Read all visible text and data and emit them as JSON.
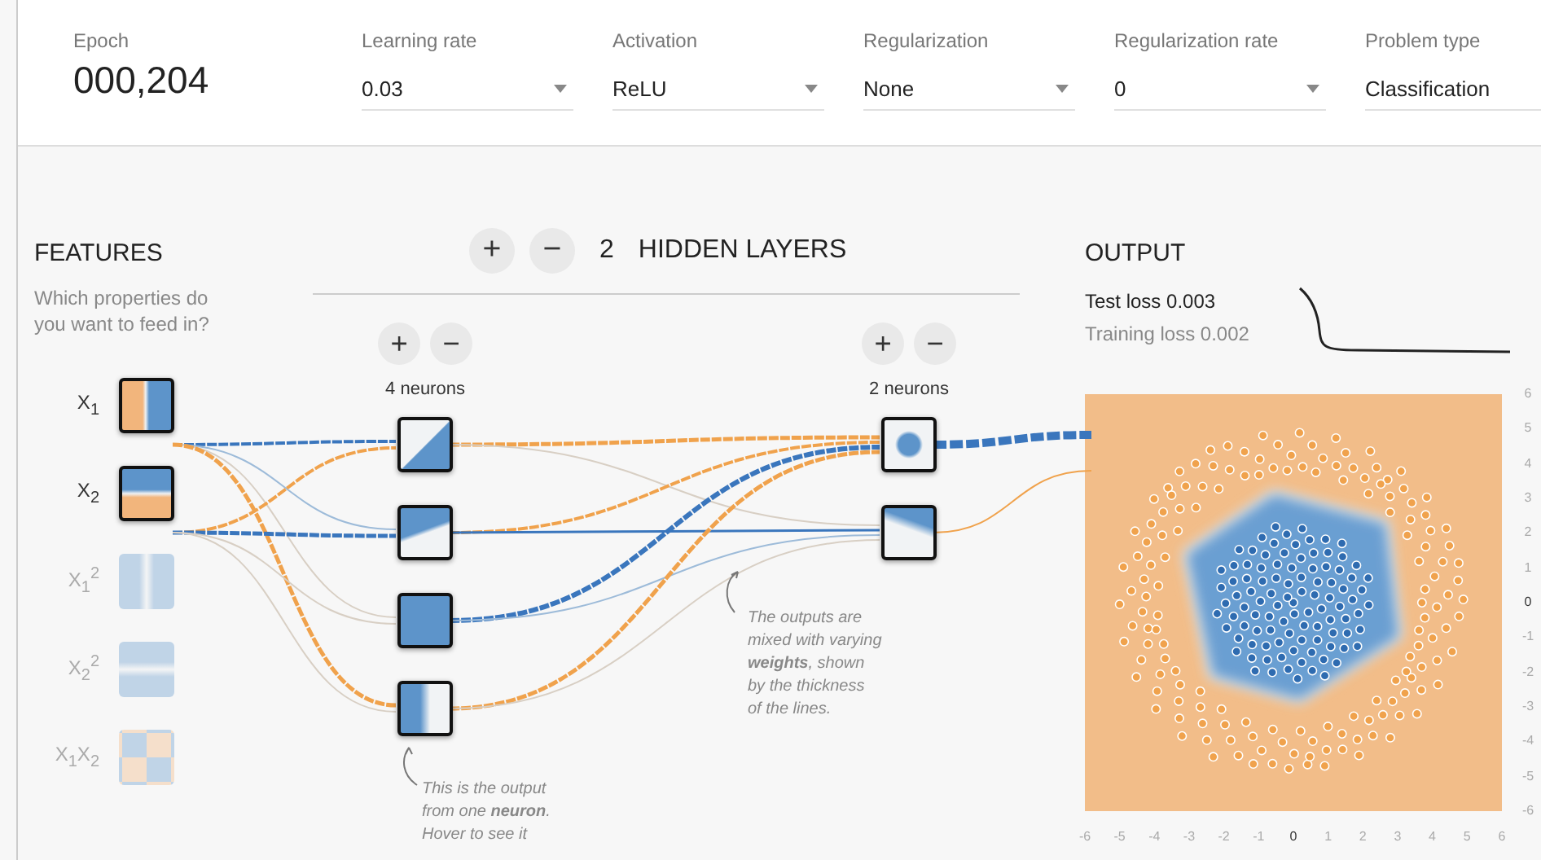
{
  "controls": [
    {
      "kind": "counter",
      "label": "Epoch",
      "value": "000,204"
    },
    {
      "kind": "dropdown",
      "label": "Learning rate",
      "value": "0.03"
    },
    {
      "kind": "dropdown",
      "label": "Activation",
      "value": "ReLU"
    },
    {
      "kind": "dropdown",
      "label": "Regularization",
      "value": "None"
    },
    {
      "kind": "dropdown",
      "label": "Regularization rate",
      "value": "0"
    },
    {
      "kind": "dropdown",
      "label": "Problem type",
      "value": "Classification"
    }
  ],
  "features": {
    "title": "FEATURES",
    "description": "Which properties do you want to feed in?",
    "inputs": [
      {
        "label": "X$_{1}$",
        "selected": true,
        "kind": "vertical"
      },
      {
        "label": "X$_{2}$",
        "selected": true,
        "kind": "horizontal"
      },
      {
        "label": "X$_{1}$$^{2}$",
        "selected": false,
        "kind": "vertical-band"
      },
      {
        "label": "X$_{2}$$^{2}$",
        "selected": false,
        "kind": "horizontal-band"
      },
      {
        "label": "X$_{1}$X$_{2}$",
        "selected": false,
        "kind": "checker"
      }
    ]
  },
  "hidden_layers": {
    "add": "+",
    "remove": "−",
    "count": "2",
    "title": "HIDDEN LAYERS",
    "layers": [
      {
        "add": "+",
        "remove": "−",
        "label": "4 neurons",
        "neurons": [
          {
            "kind": "diagonal"
          },
          {
            "kind": "top-wedge"
          },
          {
            "kind": "solid"
          },
          {
            "kind": "left-band"
          }
        ]
      },
      {
        "add": "+",
        "remove": "−",
        "label": "2 neurons",
        "neurons": [
          {
            "kind": "blob"
          },
          {
            "kind": "top-corner"
          }
        ]
      }
    ]
  },
  "notes": [
    {
      "lines": [
        "This is the output",
        "from one **neuron**.",
        "Hover to see it"
      ]
    },
    {
      "lines": [
        "The outputs are",
        "mixed with varying",
        "**weights**, shown",
        "by the thickness",
        "of the lines."
      ]
    }
  ],
  "output": {
    "title": "OUTPUT",
    "test_loss": "Test loss 0.003",
    "training_loss": "Training loss 0.002",
    "y_ticks": [
      "6",
      "5",
      "4",
      "3",
      "2",
      "1",
      "0",
      "-1",
      "-2",
      "-3",
      "-4",
      "-5",
      "-6"
    ],
    "x_ticks": [
      "-6",
      "-5",
      "-4",
      "-3",
      "-2",
      "-1",
      "0",
      "1",
      "2",
      "3",
      "4",
      "5",
      "6"
    ]
  }
}
